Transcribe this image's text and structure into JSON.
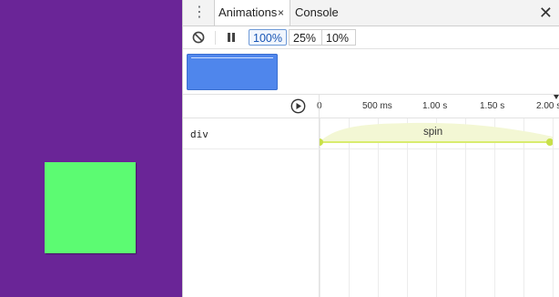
{
  "tabs": {
    "menu_icon": "more-vert-icon",
    "animations_label": "Animations",
    "animations_close": "×",
    "console_label": "Console",
    "close_devtools": "✕"
  },
  "controls": {
    "clear_icon": "block-icon",
    "pause_icon": "pause-icon",
    "speeds": [
      "100%",
      "25%",
      "10%"
    ],
    "selected_speed": "100%"
  },
  "timeline": {
    "replay_icon": "replay-icon",
    "ticks": [
      "0",
      "500 ms",
      "1.00 s",
      "1.50 s",
      "2.00 s"
    ]
  },
  "animation": {
    "target": "div",
    "name": "spin",
    "start_s": 0,
    "end_s": 2.0,
    "track_color": "#d9ec6f",
    "endpoint_color": "#c8e04a"
  },
  "colors": {
    "page_background": "#6a2597",
    "box": "#5cfb72",
    "thumbnail": "#4f86ec",
    "active_speed": "#1a57b5"
  }
}
